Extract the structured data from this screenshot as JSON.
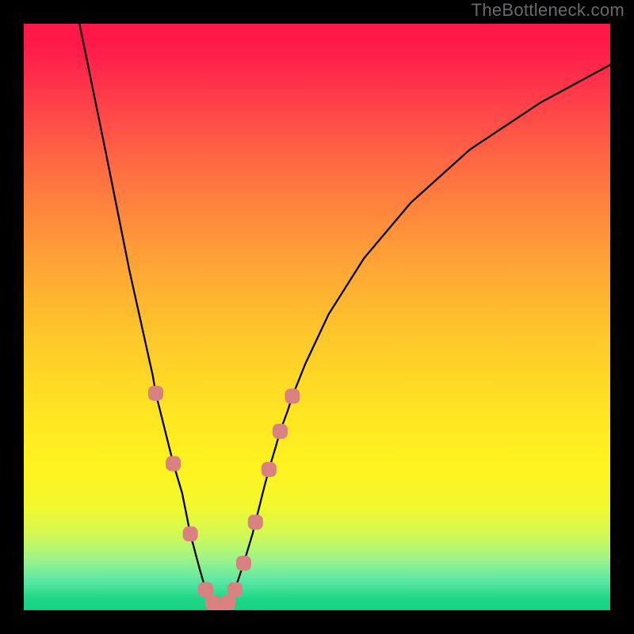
{
  "watermark": "TheBottleneck.com",
  "chart_data": {
    "type": "line",
    "title": "",
    "xlabel": "",
    "ylabel": "",
    "xlim": [
      0,
      100
    ],
    "ylim": [
      0,
      100
    ],
    "minimum_x": 33,
    "series": [
      {
        "name": "curve",
        "points": [
          {
            "x": 9.5,
            "y": 100
          },
          {
            "x": 14,
            "y": 78
          },
          {
            "x": 18,
            "y": 58
          },
          {
            "x": 22,
            "y": 40
          },
          {
            "x": 22.5,
            "y": 37
          },
          {
            "x": 25,
            "y": 27
          },
          {
            "x": 25.5,
            "y": 25
          },
          {
            "x": 27,
            "y": 20
          },
          {
            "x": 28,
            "y": 15
          },
          {
            "x": 28.4,
            "y": 13
          },
          {
            "x": 30,
            "y": 7
          },
          {
            "x": 31,
            "y": 3.5
          },
          {
            "x": 32,
            "y": 1.5
          },
          {
            "x": 33,
            "y": 0.6
          },
          {
            "x": 34,
            "y": 0.6
          },
          {
            "x": 35,
            "y": 1.5
          },
          {
            "x": 36,
            "y": 3.5
          },
          {
            "x": 37.5,
            "y": 8
          },
          {
            "x": 39,
            "y": 13
          },
          {
            "x": 39.5,
            "y": 15
          },
          {
            "x": 41,
            "y": 21
          },
          {
            "x": 41.8,
            "y": 24
          },
          {
            "x": 43,
            "y": 28
          },
          {
            "x": 43.7,
            "y": 30.5
          },
          {
            "x": 45,
            "y": 34
          },
          {
            "x": 45.8,
            "y": 36.5
          },
          {
            "x": 48,
            "y": 42
          },
          {
            "x": 52,
            "y": 50.5
          },
          {
            "x": 58,
            "y": 60
          },
          {
            "x": 66,
            "y": 69.5
          },
          {
            "x": 76,
            "y": 78.5
          },
          {
            "x": 88,
            "y": 86.5
          },
          {
            "x": 100,
            "y": 93
          }
        ]
      },
      {
        "name": "markers",
        "points": [
          {
            "x": 22.5,
            "y": 37
          },
          {
            "x": 25.5,
            "y": 25
          },
          {
            "x": 28.4,
            "y": 13
          },
          {
            "x": 31.0,
            "y": 3.5
          },
          {
            "x": 32.2,
            "y": 1.3
          },
          {
            "x": 33.0,
            "y": 0.6
          },
          {
            "x": 34.0,
            "y": 0.6
          },
          {
            "x": 34.8,
            "y": 1.3
          },
          {
            "x": 36.0,
            "y": 3.5
          },
          {
            "x": 37.5,
            "y": 8
          },
          {
            "x": 39.5,
            "y": 15
          },
          {
            "x": 41.8,
            "y": 24
          },
          {
            "x": 43.7,
            "y": 30.5
          },
          {
            "x": 45.8,
            "y": 36.5
          }
        ]
      }
    ]
  }
}
